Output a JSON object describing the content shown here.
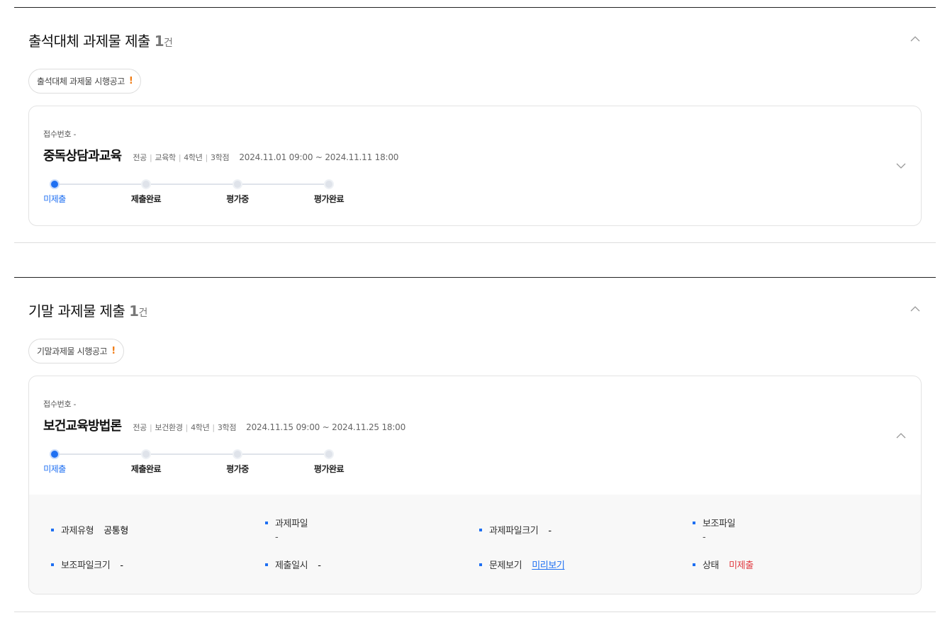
{
  "sections": [
    {
      "title": "출석대체 과제물 제출",
      "count": "1",
      "count_unit": "건",
      "notice_label": "출석대체 과제물 시행공고",
      "notice_mark": "!",
      "card": {
        "receipt_label": "접수번호",
        "receipt_value": "-",
        "course_name": "중독상담과교육",
        "meta": [
          "전공",
          "교육학",
          "4학년",
          "3학점"
        ],
        "period": "2024.11.01 09:00 ~ 2024.11.11 18:00",
        "steps": [
          "미제출",
          "제출완료",
          "평가중",
          "평가완료"
        ],
        "active_step": 0
      }
    },
    {
      "title": "기말 과제물 제출",
      "count": "1",
      "count_unit": "건",
      "notice_label": "기말과제물 시행공고",
      "notice_mark": "!",
      "card": {
        "receipt_label": "접수번호",
        "receipt_value": "-",
        "course_name": "보건교육방법론",
        "meta": [
          "전공",
          "보건환경",
          "4학년",
          "3학점"
        ],
        "period": "2024.11.15 09:00 ~ 2024.11.25 18:00",
        "steps": [
          "미제출",
          "제출완료",
          "평가중",
          "평가완료"
        ],
        "active_step": 0,
        "details": {
          "type_label": "과제유형",
          "type_value": "공통형",
          "file_label": "과제파일",
          "file_value": "-",
          "file_size_label": "과제파일크기",
          "file_size_value": "-",
          "aux_file_label": "보조파일",
          "aux_file_value": "-",
          "aux_size_label": "보조파일크기",
          "aux_size_value": "-",
          "submit_time_label": "제출일시",
          "submit_time_value": "-",
          "preview_label": "문제보기",
          "preview_link": "미리보기",
          "status_label": "상태",
          "status_value": "미제출"
        }
      }
    }
  ],
  "icons": {
    "section_collapse": "chevron-up-icon",
    "card1_toggle": "chevron-down-icon",
    "card2_toggle": "chevron-up-icon"
  },
  "colors": {
    "accent": "#1e6ff2",
    "warning": "#f07b13",
    "status_red": "#e0383e"
  }
}
